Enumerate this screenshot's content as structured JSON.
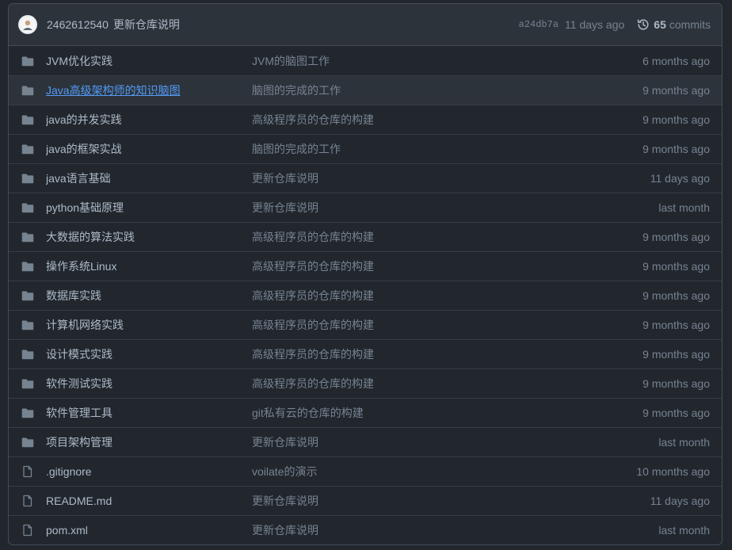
{
  "latest_commit": {
    "author": "2462612540",
    "message": "更新仓库说明",
    "sha": "a24db7a",
    "time": "11 days ago",
    "commit_count": "65",
    "commits_label": "commits"
  },
  "files": [
    {
      "type": "folder",
      "name": "JVM优化实践",
      "message": "JVM的脑图工作",
      "time": "6 months ago"
    },
    {
      "type": "folder",
      "name": "Java高级架构师的知识脑图",
      "message": "脑图的完成的工作",
      "time": "9 months ago"
    },
    {
      "type": "folder",
      "name": "java的并发实践",
      "message": "高级程序员的仓库的构建",
      "time": "9 months ago"
    },
    {
      "type": "folder",
      "name": "java的框架实战",
      "message": "脑图的完成的工作",
      "time": "9 months ago"
    },
    {
      "type": "folder",
      "name": "java语言基础",
      "message": "更新仓库说明",
      "time": "11 days ago"
    },
    {
      "type": "folder",
      "name": "python基础原理",
      "message": "更新仓库说明",
      "time": "last month"
    },
    {
      "type": "folder",
      "name": "大数据的算法实践",
      "message": "高级程序员的仓库的构建",
      "time": "9 months ago"
    },
    {
      "type": "folder",
      "name": "操作系统Linux",
      "message": "高级程序员的仓库的构建",
      "time": "9 months ago"
    },
    {
      "type": "folder",
      "name": "数据库实践",
      "message": "高级程序员的仓库的构建",
      "time": "9 months ago"
    },
    {
      "type": "folder",
      "name": "计算机网络实践",
      "message": "高级程序员的仓库的构建",
      "time": "9 months ago"
    },
    {
      "type": "folder",
      "name": "设计模式实践",
      "message": "高级程序员的仓库的构建",
      "time": "9 months ago"
    },
    {
      "type": "folder",
      "name": "软件测试实践",
      "message": "高级程序员的仓库的构建",
      "time": "9 months ago"
    },
    {
      "type": "folder",
      "name": "软件管理工具",
      "message": "git私有云的仓库的构建",
      "time": "9 months ago"
    },
    {
      "type": "folder",
      "name": "项目架构管理",
      "message": "更新仓库说明",
      "time": "last month"
    },
    {
      "type": "file",
      "name": ".gitignore",
      "message": "voilate的演示",
      "time": "10 months ago"
    },
    {
      "type": "file",
      "name": "README.md",
      "message": "更新仓库说明",
      "time": "11 days ago"
    },
    {
      "type": "file",
      "name": "pom.xml",
      "message": "更新仓库说明",
      "time": "last month"
    }
  ],
  "colors": {
    "background": "#22272e",
    "header": "#2d333b",
    "border": "#444c56",
    "link": "#539bf5",
    "folder_icon": "#768390"
  }
}
